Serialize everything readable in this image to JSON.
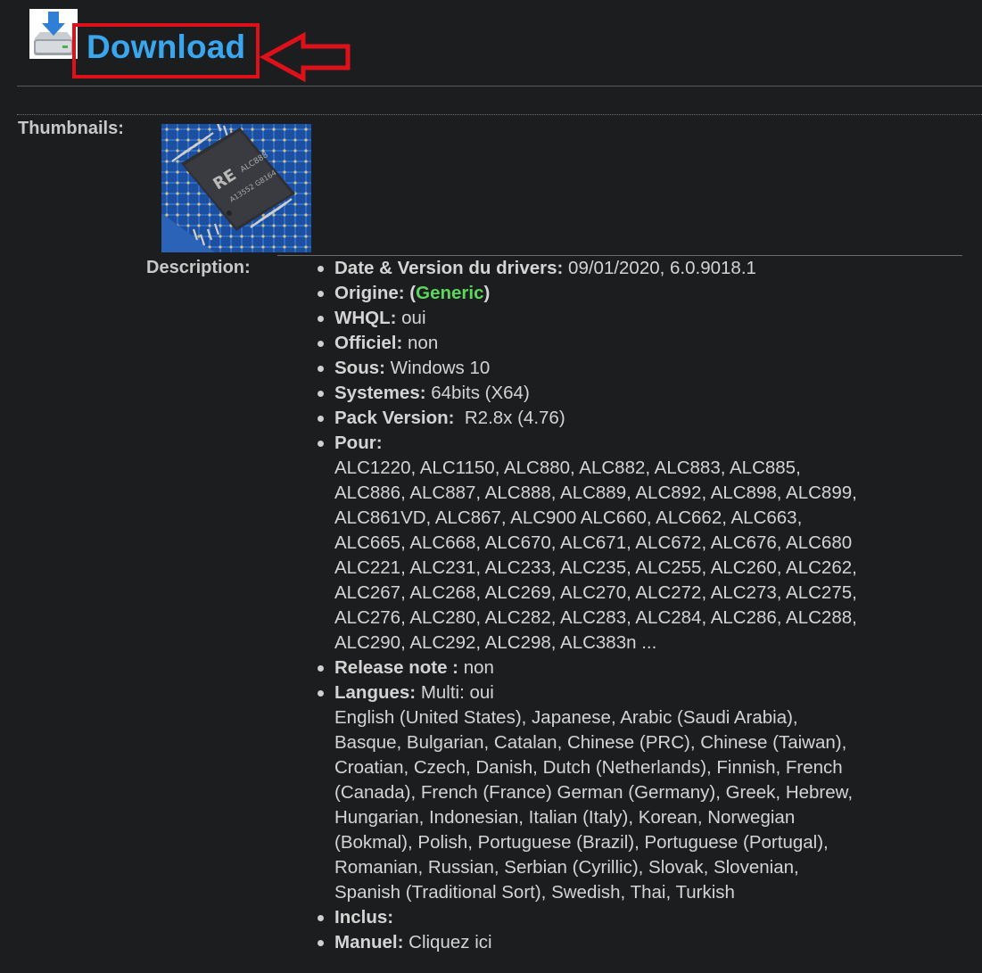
{
  "download": {
    "link_text": "Download",
    "link_color": "#3aa6ee",
    "highlight_color": "#e0101a",
    "icon": "download-drive-icon"
  },
  "thumbnails": {
    "label": "Thumbnails:",
    "image": "realtek-audio-chip-thumbnail"
  },
  "description": {
    "label": "Description:",
    "items": [
      {
        "key": "Date & Version du drivers:",
        "value": " 09/01/2020, 6.0.9018.1"
      },
      {
        "key": "Origine:",
        "value_pre": " (",
        "value_highlight": "Generic",
        "value_post": ")",
        "highlight_color": "#5cd65c"
      },
      {
        "key": "WHQL:",
        "value": " oui"
      },
      {
        "key": "Officiel:",
        "value": " non"
      },
      {
        "key": "Sous:",
        "value": " Windows 10"
      },
      {
        "key": "Systemes:",
        "value": " 64bits (X64)"
      },
      {
        "key": "Pack Version:",
        "value": "  R2.8x (4.76)"
      },
      {
        "key": "Pour:",
        "value": "",
        "detail_lines": [
          "ALC1220, ALC1150, ALC880, ALC882, ALC883, ALC885,",
          "ALC886, ALC887, ALC888, ALC889, ALC892, ALC898, ALC899,",
          "ALC861VD, ALC867, ALC900 ALC660, ALC662, ALC663,",
          "ALC665, ALC668, ALC670, ALC671, ALC672, ALC676, ALC680",
          "ALC221, ALC231, ALC233, ALC235, ALC255, ALC260, ALC262,",
          "ALC267, ALC268, ALC269, ALC270, ALC272, ALC273, ALC275,",
          "ALC276, ALC280, ALC282, ALC283, ALC284, ALC286, ALC288,",
          "ALC290, ALC292, ALC298, ALC383n ..."
        ]
      },
      {
        "key": "Release note :",
        "value": " non"
      },
      {
        "key": "Langues:",
        "value": " Multi: oui",
        "detail_lines": [
          "English (United States), Japanese, Arabic (Saudi Arabia),",
          "Basque, Bulgarian, Catalan, Chinese (PRC), Chinese (Taiwan),",
          "Croatian, Czech, Danish, Dutch (Netherlands), Finnish, French",
          "(Canada), French (France) German (Germany), Greek, Hebrew,",
          "Hungarian, Indonesian, Italian (Italy), Korean, Norwegian",
          "(Bokmal), Polish, Portuguese (Brazil), Portuguese (Portugal),",
          "Romanian, Russian, Serbian (Cyrillic), Slovak, Slovenian,",
          "Spanish (Traditional Sort), Swedish, Thai, Turkish"
        ]
      },
      {
        "key": "Inclus:",
        "value": ""
      },
      {
        "key": "Manuel:",
        "value": " Cliquez ici"
      }
    ]
  }
}
